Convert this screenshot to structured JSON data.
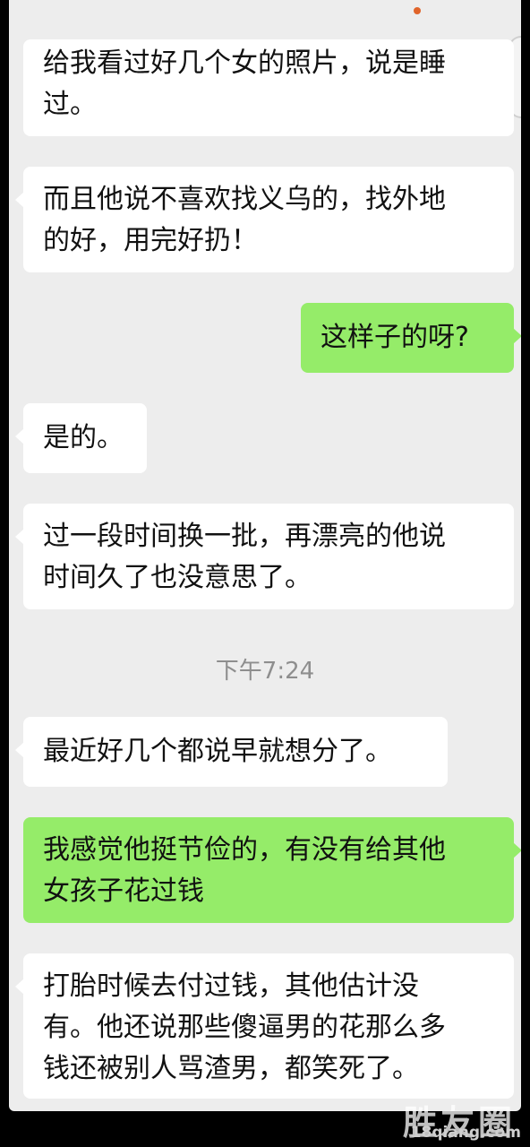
{
  "messages": [
    {
      "side": "recv",
      "text": "给我看过好几个女的照片，说是睡\n过。"
    },
    {
      "side": "recv",
      "text": "而且他说不喜欢找义乌的，找外地\n的好，用完好扔！"
    },
    {
      "side": "sent",
      "text": "这样子的呀?"
    },
    {
      "side": "recv",
      "text": "是的。"
    },
    {
      "side": "recv",
      "text": "过一段时间换一批，再漂亮的他说\n时间久了也没意思了。"
    },
    {
      "side": "recv",
      "text": "最近好几个都说早就想分了。"
    },
    {
      "side": "sent",
      "text": "我感觉他挺节俭的，有没有给其他\n女孩子花过钱"
    },
    {
      "side": "recv",
      "text": "打胎时候去付过钱，其他估计没\n有。他还说那些傻逼男的花那么多\n钱还被别人骂渣男，都笑死了。"
    }
  ],
  "timestamp": "下午7:24",
  "watermark": {
    "cn": "胜友圈",
    "url": "18qiang.com"
  },
  "colors": {
    "sent": "#95ec69",
    "recv": "#ffffff",
    "background": "#ededed"
  }
}
